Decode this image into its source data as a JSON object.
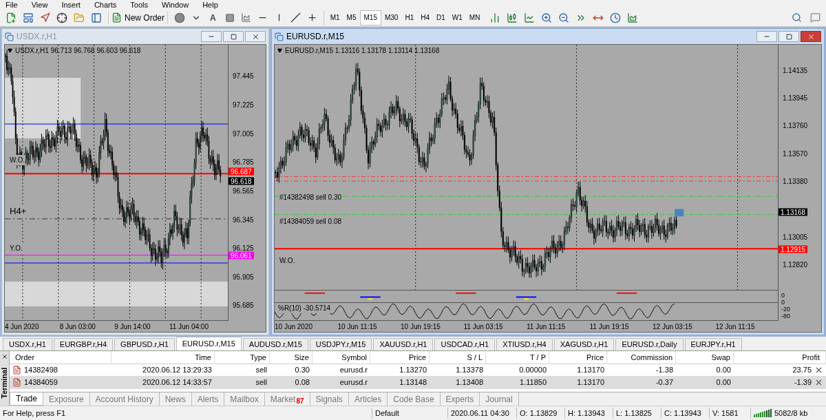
{
  "menu": [
    "File",
    "View",
    "Insert",
    "Charts",
    "Tools",
    "Window",
    "Help"
  ],
  "toolbar": {
    "new_order": "New Order",
    "text_tool": "A",
    "timeframes": [
      {
        "label": "M1",
        "selected": false
      },
      {
        "label": "M5",
        "selected": false
      },
      {
        "label": "M15",
        "selected": true
      },
      {
        "label": "M30",
        "selected": false
      },
      {
        "label": "H1",
        "selected": false
      },
      {
        "label": "H4",
        "selected": false
      },
      {
        "label": "D1",
        "selected": false
      },
      {
        "label": "W1",
        "selected": false
      },
      {
        "label": "MN",
        "selected": false
      }
    ]
  },
  "windows": [
    {
      "title": "USDX.r,H1",
      "active": false,
      "header": "USDX.r,H1  96.713 96.768 96.603 96.618",
      "price_ticks": [
        "97.445",
        "97.225",
        "97.005",
        "96.785",
        "96.565",
        "96.345",
        "96.125",
        "95.905",
        "95.685"
      ],
      "price_tags": [
        {
          "text": "96.687",
          "color": "#ff0000"
        },
        {
          "text": "96.618",
          "color": "#000000"
        },
        {
          "text": "96.061",
          "color": "#ff00ff"
        }
      ],
      "line_labels": [
        "W.O.",
        "H4+",
        "Y.O."
      ],
      "time_ticks": [
        "4 Jun 2020",
        "8 Jun 03:00",
        "9 Jun 14:00",
        "11 Jun 04:00"
      ]
    },
    {
      "title": "EURUSD.r,M15",
      "active": true,
      "header": "EURUSD.r,M15  1.13116 1.13178 1.13114 1.13168",
      "price_ticks": [
        "1.14135",
        "1.13945",
        "1.13760",
        "1.13570",
        "1.13380",
        "1.13005",
        "1.12820"
      ],
      "price_tags": [
        {
          "text": "1.13168",
          "color": "#000000"
        },
        {
          "text": "1.12915",
          "color": "#ff0000"
        }
      ],
      "line_labels": [
        "#14382498 sell 0.30",
        "#14384059 sell 0.08",
        "W.O."
      ],
      "indicator": {
        "label": "%R(10) -30.5714",
        "ticks": [
          "0",
          "0",
          "-20",
          "-80"
        ]
      },
      "time_ticks": [
        "10 Jun 2020",
        "10 Jun 11:15",
        "10 Jun 19:15",
        "11 Jun 03:15",
        "11 Jun 11:15",
        "11 Jun 19:15",
        "12 Jun 03:15",
        "12 Jun 11:15"
      ]
    }
  ],
  "chart_tabs": [
    {
      "label": "USDX.r,H1",
      "selected": false
    },
    {
      "label": "EURGBP.r,H4",
      "selected": false
    },
    {
      "label": "GBPUSD.r,H1",
      "selected": false
    },
    {
      "label": "EURUSD.r,M15",
      "selected": true
    },
    {
      "label": "AUDUSD.r,M15",
      "selected": false
    },
    {
      "label": "USDJPY.r,M15",
      "selected": false
    },
    {
      "label": "XAUUSD.r,H1",
      "selected": false
    },
    {
      "label": "USDCAD.r,H1",
      "selected": false
    },
    {
      "label": "XTIUSD.r,H4",
      "selected": false
    },
    {
      "label": "XAGUSD.r,H1",
      "selected": false
    },
    {
      "label": "EURUSD.r,Daily",
      "selected": false
    },
    {
      "label": "EURJPY.r,H1",
      "selected": false
    }
  ],
  "terminal": {
    "label": "Terminal",
    "columns": [
      "Order",
      "Time",
      "Type",
      "Size",
      "Symbol",
      "Price",
      "S / L",
      "T / P",
      "Price",
      "Commission",
      "Swap",
      "Profit"
    ],
    "rows": [
      {
        "selected": false,
        "cells": [
          "14382498",
          "2020.06.12 13:29:33",
          "sell",
          "0.30",
          "eurusd.r",
          "1.13270",
          "1.13378",
          "0.00000",
          "1.13170",
          "-1.38",
          "0.00",
          "23.75"
        ]
      },
      {
        "selected": true,
        "cells": [
          "14384059",
          "2020.06.12 14:33:57",
          "sell",
          "0.08",
          "eurusd.r",
          "1.13148",
          "1.13408",
          "1.11850",
          "1.13170",
          "-0.37",
          "0.00",
          "-1.39"
        ]
      }
    ],
    "tabs": [
      {
        "label": "Trade",
        "selected": true
      },
      {
        "label": "Exposure",
        "selected": false
      },
      {
        "label": "Account History",
        "selected": false
      },
      {
        "label": "News",
        "selected": false
      },
      {
        "label": "Alerts",
        "selected": false
      },
      {
        "label": "Mailbox",
        "selected": false
      },
      {
        "label": "Market",
        "badge": "87",
        "selected": false
      },
      {
        "label": "Signals",
        "selected": false
      },
      {
        "label": "Articles",
        "selected": false
      },
      {
        "label": "Code Base",
        "selected": false
      },
      {
        "label": "Experts",
        "selected": false
      },
      {
        "label": "Journal",
        "selected": false
      }
    ]
  },
  "status_bar": {
    "help": "For Help, press F1",
    "profile": "Default",
    "time": "2020.06.11 04:30",
    "open": "O: 1.13829",
    "high": "H: 1.13943",
    "low": "L: 1.13825",
    "close": "C: 1.13943",
    "volume": "V: 1581",
    "traffic": "5082/8 kb"
  }
}
